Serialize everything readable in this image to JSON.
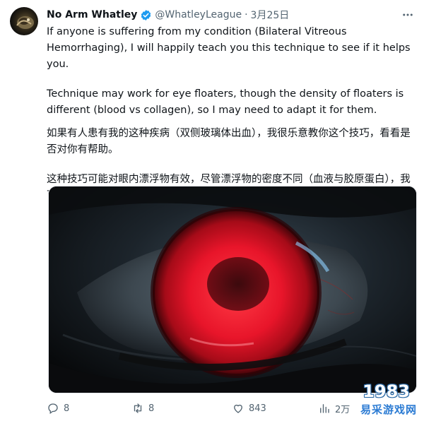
{
  "tweet": {
    "author_name": "No Arm Whatley",
    "handle": "@WhatleyLeague",
    "separator": "·",
    "date": "3月25日",
    "more_icon": "more-horizontal-icon",
    "verified_icon": "verified-badge-icon",
    "verified_color": "#1d9bf0",
    "paragraphs_en": [
      "If anyone is suffering from my condition (Bilateral Vitreous Hemorrhaging), I will happily teach you this technique to see if it helps you.",
      "Technique may work for eye floaters, though the density of floaters is different (blood vs collagen), so I may need to adapt it for them."
    ],
    "paragraphs_zh": [
      "如果有人患有我的这种疾病（双侧玻璃体出血），我很乐意教你这个技巧，看看是否对你有帮助。",
      "这种技巧可能对眼内漂浮物有效，尽管漂浮物的密度不同（血液与胶原蛋白），我可能需要对其进行调整。"
    ]
  },
  "media": {
    "description_icon": "red-eye-image",
    "iris_color": "#e8152a"
  },
  "actions": {
    "reply_count": "8",
    "retweet_count": "8",
    "like_count": "843",
    "views_count": "2万",
    "icon_color": "#536471"
  },
  "watermark": {
    "number": "1983",
    "text": "易采游戏网"
  }
}
